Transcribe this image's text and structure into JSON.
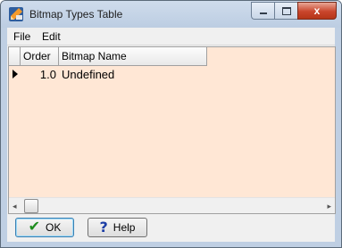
{
  "window": {
    "title": "Bitmap Types Table",
    "icon": "app-pencil-ruler-icon",
    "close_glyph": "x"
  },
  "menu": {
    "items": [
      {
        "label": "File"
      },
      {
        "label": "Edit"
      }
    ]
  },
  "grid": {
    "columns": [
      {
        "label": "Order"
      },
      {
        "label": "Bitmap Name"
      }
    ],
    "rows": [
      {
        "order": "1.0",
        "name": "Undefined",
        "current": true
      }
    ],
    "background": "#ffe7d5"
  },
  "scrollbar": {
    "left_arrow": "◂",
    "right_arrow": "▸"
  },
  "buttons": {
    "ok_label": "OK",
    "help_label": "Help",
    "ok_icon": "checkmark-icon",
    "help_icon": "question-mark-icon",
    "ok_glyph": "✔",
    "help_glyph": "?"
  }
}
